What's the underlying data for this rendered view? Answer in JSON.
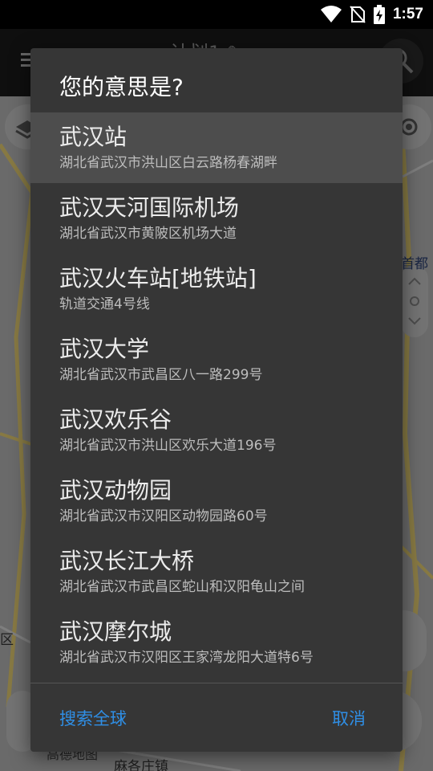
{
  "status_bar": {
    "time": "1:57"
  },
  "app_bar": {
    "title": "计划1 ✎"
  },
  "dialog": {
    "title": "您的意思是?",
    "items": [
      {
        "name": "武汉站",
        "address": "湖北省武汉市洪山区白云路杨春湖畔",
        "selected": true
      },
      {
        "name": "武汉天河国际机场",
        "address": "湖北省武汉市黄陂区机场大道"
      },
      {
        "name": "武汉火车站[地铁站]",
        "address": "轨道交通4号线"
      },
      {
        "name": "武汉大学",
        "address": "湖北省武汉市武昌区八一路299号"
      },
      {
        "name": "武汉欢乐谷",
        "address": "湖北省武汉市洪山区欢乐大道196号"
      },
      {
        "name": "武汉动物园",
        "address": "湖北省武汉市汉阳区动物园路60号"
      },
      {
        "name": "武汉长江大桥",
        "address": "湖北省武汉市武昌区蛇山和汉阳龟山之间"
      },
      {
        "name": "武汉摩尔城",
        "address": "湖北省武汉市汉阳区王家湾龙阳大道特6号"
      }
    ],
    "search_global_label": "搜索全球",
    "cancel_label": "取消"
  },
  "map": {
    "labels": [
      "首都",
      "区",
      "高德地图",
      "麻各庄镇"
    ]
  },
  "colors": {
    "accent": "#2f8fe6",
    "dialog_bg": "#363636",
    "selected_bg": "#4d4d4d"
  }
}
